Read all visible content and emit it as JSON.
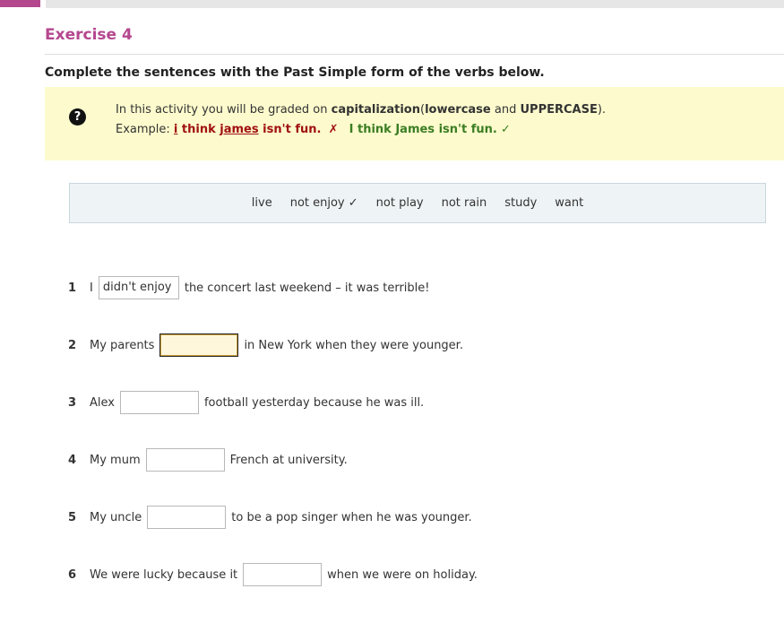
{
  "exercise": {
    "title": "Exercise 4",
    "instruction": "Complete the sentences with the Past Simple form of the verbs below."
  },
  "info": {
    "icon": "question-circle-icon",
    "line1_prefix": "In this activity you will be graded on",
    "line1_capitalization": "capitalization",
    "line1_open_paren": "(",
    "line1_lowercase": "lowercase",
    "line1_and": "and",
    "line1_uppercase": "UPPERCASE",
    "line1_close": ").",
    "example_label": "Example:",
    "wrong_i": "i",
    "wrong_think": "think",
    "wrong_james": "james",
    "wrong_rest": "isn't fun.",
    "cross": "✗",
    "correct_example": "I think James isn't fun.",
    "tick": "✓"
  },
  "word_bank": [
    "live",
    "not enjoy ✓",
    "not play",
    "not rain",
    "study",
    "want"
  ],
  "questions": [
    {
      "num": "1",
      "before": "I",
      "value": "didn't enjoy",
      "after": "the concert last weekend – it was terrible!"
    },
    {
      "num": "2",
      "before": "My parents",
      "value": "",
      "after": "in New York when they were younger."
    },
    {
      "num": "3",
      "before": "Alex",
      "value": "",
      "after": "football yesterday because he was ill."
    },
    {
      "num": "4",
      "before": "My mum",
      "value": "",
      "after": "French at university."
    },
    {
      "num": "5",
      "before": "My uncle",
      "value": "",
      "after": "to be a pop singer when he was younger."
    },
    {
      "num": "6",
      "before": "We were lucky because it",
      "value": "",
      "after": "when we were on holiday."
    }
  ],
  "colors": {
    "accent": "#b5478f",
    "info_bg": "#fdfbcd",
    "wrong": "#a01010",
    "correct": "#3b7d23",
    "word_bank_bg": "#eef3f6"
  }
}
